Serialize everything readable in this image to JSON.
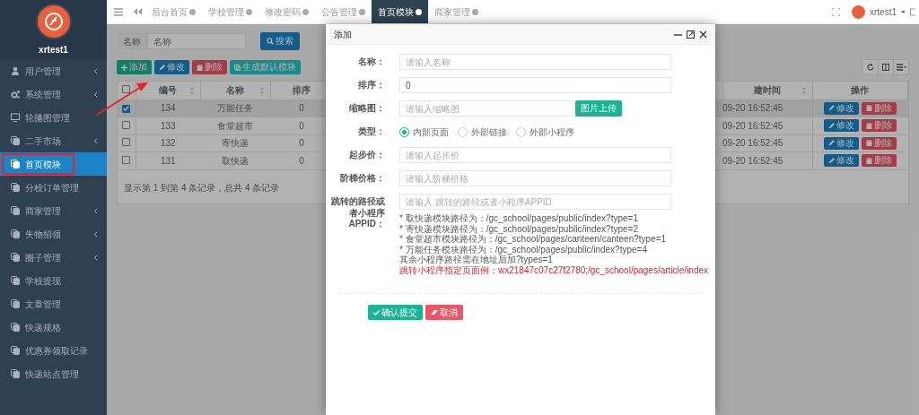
{
  "sidebar": {
    "username": "xrtest1",
    "items": [
      {
        "label": "用户管理",
        "kind": "user",
        "expandable": true,
        "selected": false,
        "highlighted": false
      },
      {
        "label": "系统管理",
        "kind": "gears",
        "expandable": true,
        "selected": false,
        "highlighted": false
      },
      {
        "label": "轮播图管理",
        "kind": "monitor",
        "expandable": false,
        "selected": false,
        "highlighted": false
      },
      {
        "label": "二手市场",
        "kind": "pages",
        "expandable": true,
        "selected": false,
        "highlighted": false
      },
      {
        "label": "首页模块",
        "kind": "pages",
        "expandable": false,
        "selected": true,
        "highlighted": true
      },
      {
        "label": "分校订单管理",
        "kind": "pages",
        "expandable": false,
        "selected": false,
        "highlighted": false
      },
      {
        "label": "商家管理",
        "kind": "pages",
        "expandable": true,
        "selected": false,
        "highlighted": false
      },
      {
        "label": "失物招领",
        "kind": "pages",
        "expandable": true,
        "selected": false,
        "highlighted": false
      },
      {
        "label": "圈子管理",
        "kind": "pages",
        "expandable": true,
        "selected": false,
        "highlighted": false
      },
      {
        "label": "学校提现",
        "kind": "pages",
        "expandable": false,
        "selected": false,
        "highlighted": false
      },
      {
        "label": "文章管理",
        "kind": "pages",
        "expandable": false,
        "selected": false,
        "highlighted": false
      },
      {
        "label": "快递规格",
        "kind": "pages",
        "expandable": false,
        "selected": false,
        "highlighted": false
      },
      {
        "label": "优惠券领取记录",
        "kind": "pages",
        "expandable": false,
        "selected": false,
        "highlighted": false
      },
      {
        "label": "快递站点管理",
        "kind": "pages",
        "expandable": false,
        "selected": false,
        "highlighted": false
      }
    ]
  },
  "topbar": {
    "tabs": [
      {
        "label": "后台首页",
        "selected": false
      },
      {
        "label": "学校管理",
        "selected": false
      },
      {
        "label": "修改密码",
        "selected": false
      },
      {
        "label": "公告管理",
        "selected": false
      },
      {
        "label": "首页模块",
        "selected": true
      },
      {
        "label": "商家管理",
        "selected": false
      }
    ],
    "user": "xrtest1"
  },
  "search": {
    "label": "名称",
    "placeholder": "名称",
    "button": "搜索"
  },
  "toolbar": [
    {
      "label": "添加",
      "kind": "add"
    },
    {
      "label": "修改",
      "kind": "edit"
    },
    {
      "label": "删除",
      "kind": "delete"
    },
    {
      "label": "生成默认模块",
      "kind": "generate"
    }
  ],
  "table": {
    "all_checked": false,
    "columns": [
      "编号",
      "名称",
      "排序",
      "建时间",
      "操作"
    ],
    "rows": [
      {
        "checked": true,
        "cells": [
          "134",
          "万能任务",
          "0",
          "09-20 16:52:45"
        ],
        "actions": [
          "修改",
          "删除"
        ]
      },
      {
        "checked": false,
        "cells": [
          "133",
          "食堂超市",
          "0",
          "09-20 16:52:45"
        ],
        "actions": [
          "修改",
          "删除"
        ]
      },
      {
        "checked": false,
        "cells": [
          "132",
          "寄快递",
          "0",
          "09-20 16:52:45"
        ],
        "actions": [
          "修改",
          "删除"
        ]
      },
      {
        "checked": false,
        "cells": [
          "131",
          "取快递",
          "0",
          "09-20 16:52:45"
        ],
        "actions": [
          "修改",
          "删除"
        ]
      }
    ],
    "footer": "显示第 1 到第 4 条记录，总共 4 条记录"
  },
  "modal": {
    "title": "添加",
    "fields": [
      {
        "label": "名称：",
        "kind": "text",
        "placeholder": "请输入名称"
      },
      {
        "label": "排序：",
        "kind": "text",
        "value": "0"
      },
      {
        "label": "缩略图：",
        "kind": "upload",
        "placeholder": "请输入缩略图",
        "button": "图片上传"
      },
      {
        "label": "类型：",
        "kind": "radio",
        "options": [
          {
            "label": "内部页面",
            "selected": true
          },
          {
            "label": "外部链接",
            "selected": false
          },
          {
            "label": "外部小程序",
            "selected": false
          }
        ]
      },
      {
        "label": "起步价：",
        "kind": "text",
        "placeholder": "请输入起步价"
      },
      {
        "label": "阶梯价格：",
        "kind": "text",
        "placeholder": "请输入阶梯价格"
      },
      {
        "label": "跳转的路径或者小程序APPID：",
        "kind": "text",
        "placeholder": "请输入 跳转的路径或者小程序APPID",
        "notes": [
          {
            "text": "* 取快递模块路径为：/gc_school/pages/public/index?type=1",
            "kind": "normal"
          },
          {
            "text": "* 寄快递模块路径为：/gc_school/pages/public/index?type=2",
            "kind": "normal"
          },
          {
            "text": "* 食堂超市模块路径为：/gc_school/pages/canteen/canteen?type=1",
            "kind": "normal"
          },
          {
            "text": "* 万能任务模块路径为：/gc_school/pages/public/index?type=4",
            "kind": "normal"
          },
          {
            "text": "其余小程序路径需在地址后加?types=1",
            "kind": "normal"
          },
          {
            "text": "跳转小程序指定页面例：wx21847c07c27f2780;/gc_school/pages/article/index",
            "kind": "warning"
          }
        ]
      }
    ],
    "buttons": [
      {
        "label": "确认提交",
        "kind": "confirm"
      },
      {
        "label": "取消",
        "kind": "cancel"
      }
    ]
  }
}
